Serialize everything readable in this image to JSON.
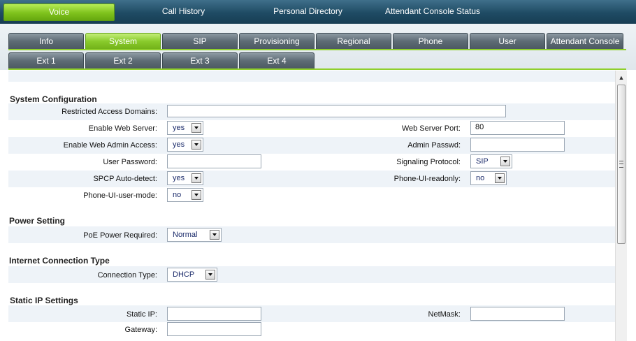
{
  "top_nav": [
    {
      "label": "Voice",
      "active": true
    },
    {
      "label": "Call History",
      "active": false
    },
    {
      "label": "Personal Directory",
      "active": false
    },
    {
      "label": "Attendant Console Status",
      "active": false
    }
  ],
  "tabs_row1": [
    {
      "label": "Info",
      "active": false
    },
    {
      "label": "System",
      "active": true
    },
    {
      "label": "SIP",
      "active": false
    },
    {
      "label": "Provisioning",
      "active": false
    },
    {
      "label": "Regional",
      "active": false
    },
    {
      "label": "Phone",
      "active": false
    },
    {
      "label": "User",
      "active": false
    },
    {
      "label": "Attendant Console",
      "active": false
    }
  ],
  "tabs_row2": [
    {
      "label": "Ext 1"
    },
    {
      "label": "Ext 2"
    },
    {
      "label": "Ext 3"
    },
    {
      "label": "Ext 4"
    }
  ],
  "system_configuration": {
    "title": "System Configuration",
    "restricted_access_domains": {
      "label": "Restricted Access Domains:",
      "value": ""
    },
    "enable_web_server": {
      "label": "Enable Web Server:",
      "value": "yes"
    },
    "web_server_port": {
      "label": "Web Server Port:",
      "value": "80"
    },
    "enable_web_admin_access": {
      "label": "Enable Web Admin Access:",
      "value": "yes"
    },
    "admin_passwd": {
      "label": "Admin Passwd:",
      "value": ""
    },
    "user_password": {
      "label": "User Password:",
      "value": ""
    },
    "signaling_protocol": {
      "label": "Signaling Protocol:",
      "value": "SIP"
    },
    "spcp_auto_detect": {
      "label": "SPCP Auto-detect:",
      "value": "yes"
    },
    "phone_ui_readonly": {
      "label": "Phone-UI-readonly:",
      "value": "no"
    },
    "phone_ui_user_mode": {
      "label": "Phone-UI-user-mode:",
      "value": "no"
    }
  },
  "power_setting": {
    "title": "Power Setting",
    "poe_power_required": {
      "label": "PoE Power Required:",
      "value": "Normal"
    }
  },
  "internet_connection_type": {
    "title": "Internet Connection Type",
    "connection_type": {
      "label": "Connection Type:",
      "value": "DHCP"
    }
  },
  "static_ip_settings": {
    "title": "Static IP Settings",
    "static_ip": {
      "label": "Static IP:",
      "value": ""
    },
    "netmask": {
      "label": "NetMask:",
      "value": ""
    },
    "gateway": {
      "label": "Gateway:",
      "value": ""
    }
  },
  "colors": {
    "active_green": "#8acb2c",
    "tab_gray": "#5e6c75",
    "topbar_blue": "#1f4b64",
    "row_band": "#eef3f8"
  },
  "icons": {
    "scroll_up": "scroll-up-arrow-icon",
    "dropdown": "chevron-down-icon"
  }
}
